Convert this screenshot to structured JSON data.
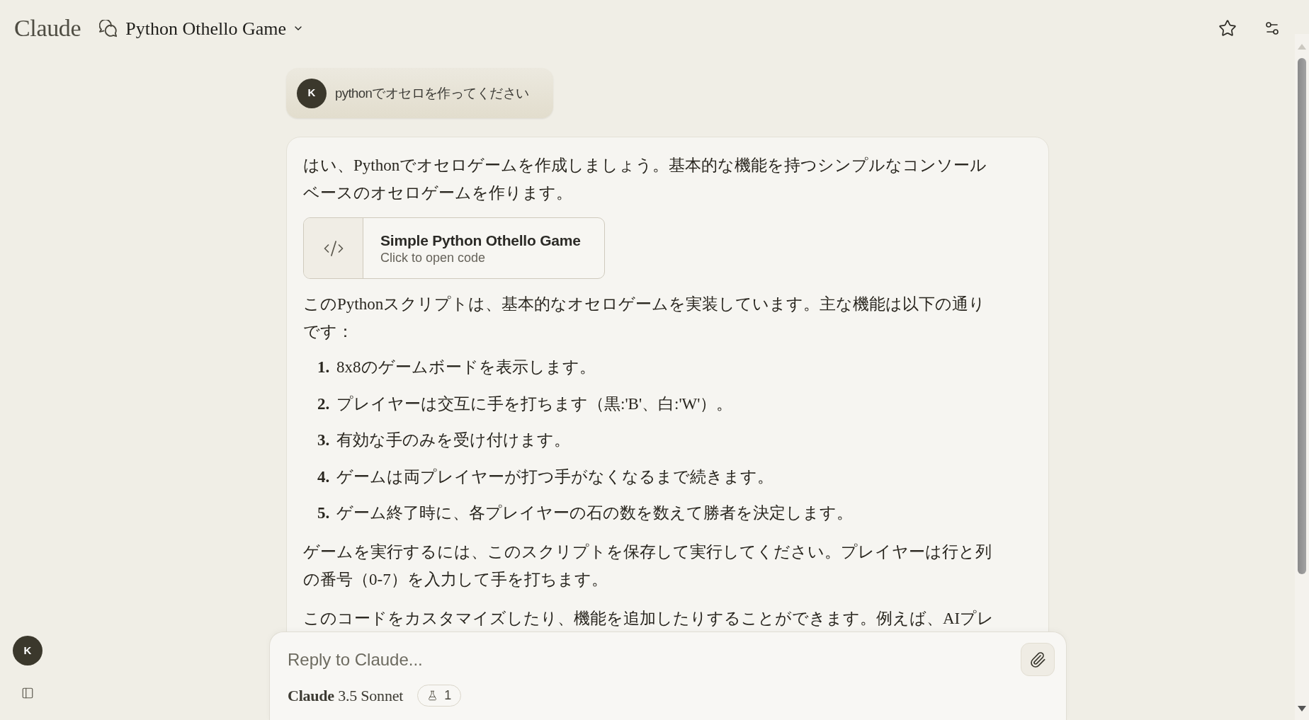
{
  "header": {
    "logo": "Claude",
    "title": "Python Othello Game"
  },
  "conversation": {
    "user_message": {
      "avatar": "K",
      "text": "pythonでオセロを作ってください"
    },
    "assistant_message": {
      "blocks": [
        {
          "kind": "paragraph",
          "text": "はい、Pythonでオセロゲームを作成しましょう。基本的な機能を持つシンプルなコンソールベースのオセロゲームを作ります。"
        },
        {
          "kind": "artifact",
          "title": "Simple Python Othello Game",
          "subtitle": "Click to open code"
        },
        {
          "kind": "paragraph",
          "text": "このPythonスクリプトは、基本的なオセロゲームを実装しています。主な機能は以下の通りです："
        },
        {
          "kind": "list",
          "items": [
            {
              "number": "1.",
              "text": "8x8のゲームボードを表示します。"
            },
            {
              "number": "2.",
              "text": "プレイヤーは交互に手を打ちます（黒:'B'、白:'W'）。"
            },
            {
              "number": "3.",
              "text": "有効な手のみを受け付けます。"
            },
            {
              "number": "4.",
              "text": "ゲームは両プレイヤーが打つ手がなくなるまで続きます。"
            },
            {
              "number": "5.",
              "text": "ゲーム終了時に、各プレイヤーの石の数を数えて勝者を決定します。"
            }
          ]
        },
        {
          "kind": "paragraph",
          "text": "ゲームを実行するには、このスクリプトを保存して実行してください。プレイヤーは行と列の番号（0-7）を入力して手を打ちます。"
        },
        {
          "kind": "paragraph",
          "text": "このコードをカスタマイズしたり、機能を追加したりすることができます。例えば、AIプレ"
        }
      ]
    }
  },
  "sidebar": {
    "avatar": "K"
  },
  "composer": {
    "placeholder": "Reply to Claude...",
    "model": "**Claude** 3.5 Sonnet",
    "badge": "1"
  }
}
